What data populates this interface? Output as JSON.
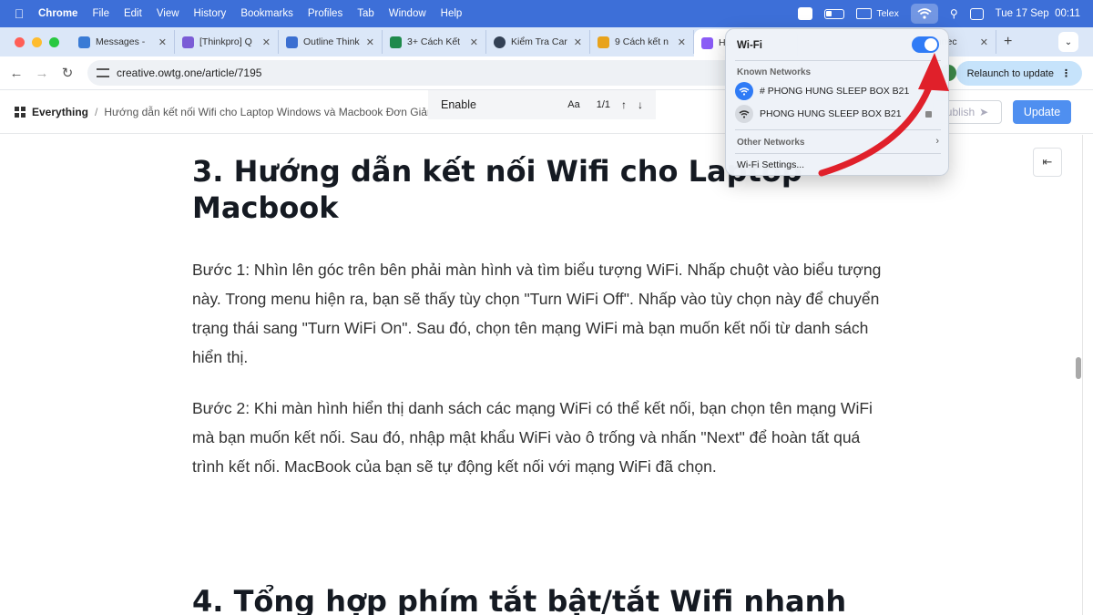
{
  "menubar": {
    "app": "Chrome",
    "items": [
      "File",
      "Edit",
      "View",
      "History",
      "Bookmarks",
      "Profiles",
      "Tab",
      "Window",
      "Help"
    ],
    "input_method": "Telex",
    "datetime": "Tue 17 Sep  00:11"
  },
  "tabs": [
    {
      "title": "Messages - ",
      "favicon_color": "#3a7bd5"
    },
    {
      "title": "[Thinkpro] Q",
      "favicon_color": "#7b5cd6"
    },
    {
      "title": "Outline Think",
      "favicon_color": "#3b6fd1"
    },
    {
      "title": "3+ Cách Kết",
      "favicon_color": "#1f8a4c"
    },
    {
      "title": "Kiểm Tra Car",
      "favicon_color": "#334155"
    },
    {
      "title": "9 Cách kết n",
      "favicon_color": "#e8a31c"
    },
    {
      "title": "Hu",
      "favicon_color": "#8b5cf6"
    },
    {
      "title": "onnec",
      "favicon_color": "#0f9d58"
    }
  ],
  "address": {
    "url": "creative.owtg.one/article/7195",
    "relaunch": "Relaunch to update"
  },
  "toolbar": {
    "root": "Everything",
    "separator": "/",
    "page": "Hướng dẫn kết nối Wifi cho Laptop Windows và Macbook Đơn Giản",
    "publish": "ublish",
    "update": "Update"
  },
  "find": {
    "query": "Enable",
    "aa": "Aa",
    "count": "1/1"
  },
  "article": {
    "h3": "3. Hướng dẫn kết nối Wifi cho Laptop Macbook",
    "p1": "Bước 1: Nhìn lên góc trên bên phải màn hình và tìm biểu tượng WiFi. Nhấp chuột vào biểu tượng này. Trong menu hiện ra, bạn sẽ thấy tùy chọn \"Turn WiFi Off\". Nhấp vào tùy chọn này để chuyển trạng thái sang \"Turn WiFi On\". Sau đó, chọn tên mạng WiFi mà bạn muốn kết nối từ danh sách hiển thị.",
    "p2": "Bước 2: Khi màn hình hiển thị danh sách các mạng WiFi có thể kết nối, bạn chọn tên mạng WiFi mà bạn muốn kết nối. Sau đó, nhập mật khẩu WiFi vào ô trống và nhấn \"Next\" để hoàn tất quá trình kết nối. MacBook của bạn sẽ tự động kết nối với mạng WiFi đã chọn.",
    "h4": "4. Tổng hợp phím tắt bật/tắt Wifi nhanh"
  },
  "wifi": {
    "title": "Wi-Fi",
    "enabled": true,
    "known_label": "Known Networks",
    "networks": [
      {
        "name": "# PHONG HUNG SLEEP BOX B21",
        "connected": true
      },
      {
        "name": "PHONG HUNG SLEEP BOX B21",
        "connected": false,
        "locked": true
      }
    ],
    "other_label": "Other Networks",
    "settings": "Wi-Fi Settings..."
  },
  "colors": {
    "menubar": "#3d6fd8",
    "accent": "#2f7bf6",
    "arrow": "#e0202a"
  }
}
